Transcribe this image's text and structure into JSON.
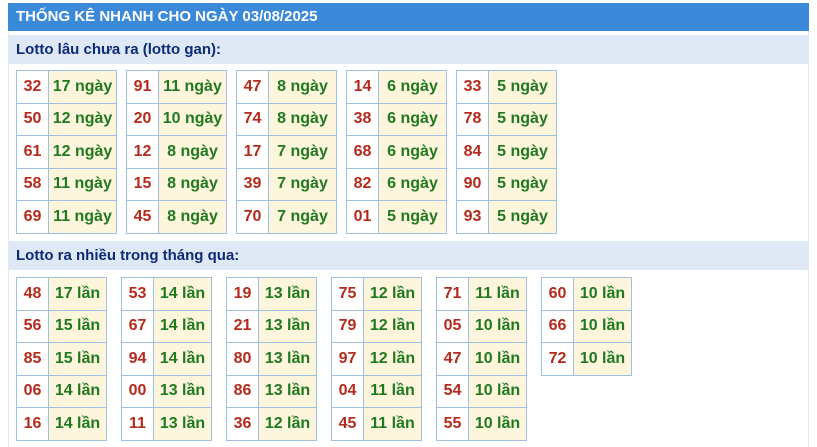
{
  "header": {
    "title": "THỐNG KÊ NHANH CHO NGÀY 03/08/2025"
  },
  "sections": [
    {
      "title": "Lotto lâu chưa ra (lotto gan):",
      "blocks": [
        [
          {
            "num": "32",
            "val": "17 ngày"
          },
          {
            "num": "50",
            "val": "12 ngày"
          },
          {
            "num": "61",
            "val": "12 ngày"
          },
          {
            "num": "58",
            "val": "11 ngày"
          },
          {
            "num": "69",
            "val": "11 ngày"
          }
        ],
        [
          {
            "num": "91",
            "val": "11 ngày"
          },
          {
            "num": "20",
            "val": "10 ngày"
          },
          {
            "num": "12",
            "val": "8 ngày"
          },
          {
            "num": "15",
            "val": "8 ngày"
          },
          {
            "num": "45",
            "val": "8 ngày"
          }
        ],
        [
          {
            "num": "47",
            "val": "8 ngày"
          },
          {
            "num": "74",
            "val": "8 ngày"
          },
          {
            "num": "17",
            "val": "7 ngày"
          },
          {
            "num": "39",
            "val": "7 ngày"
          },
          {
            "num": "70",
            "val": "7 ngày"
          }
        ],
        [
          {
            "num": "14",
            "val": "6 ngày"
          },
          {
            "num": "38",
            "val": "6 ngày"
          },
          {
            "num": "68",
            "val": "6 ngày"
          },
          {
            "num": "82",
            "val": "6 ngày"
          },
          {
            "num": "01",
            "val": "5 ngày"
          }
        ],
        [
          {
            "num": "33",
            "val": "5 ngày"
          },
          {
            "num": "78",
            "val": "5 ngày"
          },
          {
            "num": "84",
            "val": "5 ngày"
          },
          {
            "num": "90",
            "val": "5 ngày"
          },
          {
            "num": "93",
            "val": "5 ngày"
          }
        ]
      ]
    },
    {
      "title": "Lotto ra nhiều trong tháng qua:",
      "blocks": [
        [
          {
            "num": "48",
            "val": "17 lần"
          },
          {
            "num": "56",
            "val": "15 lần"
          },
          {
            "num": "85",
            "val": "15 lần"
          },
          {
            "num": "06",
            "val": "14 lần"
          },
          {
            "num": "16",
            "val": "14 lần"
          }
        ],
        [
          {
            "num": "53",
            "val": "14 lần"
          },
          {
            "num": "67",
            "val": "14 lần"
          },
          {
            "num": "94",
            "val": "14 lần"
          },
          {
            "num": "00",
            "val": "13 lần"
          },
          {
            "num": "11",
            "val": "13 lần"
          }
        ],
        [
          {
            "num": "19",
            "val": "13 lần"
          },
          {
            "num": "21",
            "val": "13 lần"
          },
          {
            "num": "80",
            "val": "13 lần"
          },
          {
            "num": "86",
            "val": "13 lần"
          },
          {
            "num": "36",
            "val": "12 lần"
          }
        ],
        [
          {
            "num": "75",
            "val": "12 lần"
          },
          {
            "num": "79",
            "val": "12 lần"
          },
          {
            "num": "97",
            "val": "12 lần"
          },
          {
            "num": "04",
            "val": "11 lần"
          },
          {
            "num": "45",
            "val": "11 lần"
          }
        ],
        [
          {
            "num": "71",
            "val": "11 lần"
          },
          {
            "num": "05",
            "val": "10 lần"
          },
          {
            "num": "47",
            "val": "10 lần"
          },
          {
            "num": "54",
            "val": "10 lần"
          },
          {
            "num": "55",
            "val": "10 lần"
          }
        ],
        [
          {
            "num": "60",
            "val": "10 lần"
          },
          {
            "num": "66",
            "val": "10 lần"
          },
          {
            "num": "72",
            "val": "10 lần"
          }
        ]
      ]
    }
  ]
}
